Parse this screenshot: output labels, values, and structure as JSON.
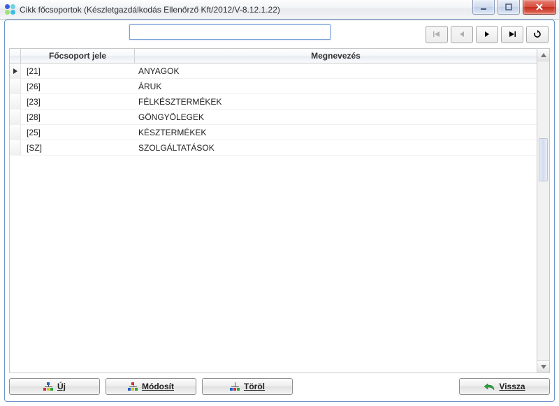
{
  "window": {
    "title": "Cikk főcsoportok (Készletgazdálkodás Ellenőrző Kft/2012/V-8.12.1.22)"
  },
  "toolbar": {
    "search_value": "",
    "search_placeholder": ""
  },
  "table": {
    "headers": {
      "code": "Főcsoport jele",
      "name": "Megnevezés"
    },
    "rows": [
      {
        "code": "[21]",
        "name": "ANYAGOK",
        "current": true
      },
      {
        "code": "[26]",
        "name": "ÁRUK",
        "current": false
      },
      {
        "code": "[23]",
        "name": "FÉLKÉSZTERMÉKEK",
        "current": false
      },
      {
        "code": "[28]",
        "name": "GÖNGYÖLEGEK",
        "current": false
      },
      {
        "code": "[25]",
        "name": "KÉSZTERMÉKEK",
        "current": false
      },
      {
        "code": "[SZ]",
        "name": "SZOLGÁLTATÁSOK",
        "current": false
      }
    ]
  },
  "buttons": {
    "new": "Új",
    "modify": "Módosít",
    "delete": "Töröl",
    "back": "Vissza"
  }
}
